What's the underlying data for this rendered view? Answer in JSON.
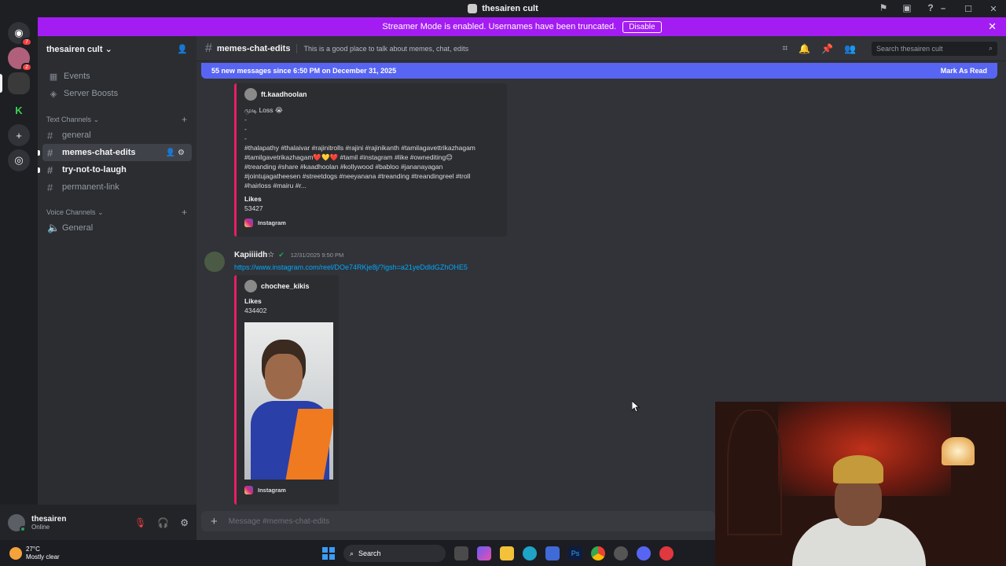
{
  "window": {
    "title": "thesairen cult",
    "controls": [
      "–",
      "☐",
      "✕"
    ]
  },
  "rail": {
    "badges": {
      "dm": "7",
      "friend": "2"
    }
  },
  "banner": {
    "text": "Streamer Mode is enabled. Usernames have been truncated.",
    "button": "Disable"
  },
  "server": {
    "name": "thesairen cult",
    "nav": [
      {
        "label": "Events",
        "icon": "calendar-icon"
      },
      {
        "label": "Server Boosts",
        "icon": "boost-icon"
      }
    ],
    "text_category": "Text Channels",
    "text_channels": [
      {
        "label": "general"
      },
      {
        "label": "memes-chat-edits",
        "active": true
      },
      {
        "label": "try-not-to-laugh",
        "unread": true
      },
      {
        "label": "permanent-link"
      }
    ],
    "voice_category": "Voice Channels",
    "voice_channels": [
      {
        "label": "General"
      }
    ]
  },
  "user": {
    "name": "thesairen",
    "status": "Online"
  },
  "channel": {
    "name": "memes-chat-edits",
    "topic": "This is a good place to talk about memes, chat, edits",
    "search_placeholder": "Search thesairen cult"
  },
  "new_messages": {
    "text": "55 new messages since 6:50 PM on December 31, 2025",
    "mark_read": "Mark As Read"
  },
  "embed1": {
    "author": "ft.kaadhoolan",
    "description_lines": [
      "முடி Loss 😭",
      "-",
      "-",
      "-",
      "#thalapathy #thalaivar #rajinitrolls #rajini #rajinikanth #tamilagavettrikazhagam",
      "#tamilgavetrikazhagam❤️💛❤️ #tamil #instagram #like #ownediting😊",
      "#treanding #share #kaadhoolan #kollywood #babloo #jananayagan",
      "#jointujagatheesen #streetdogs #neeyanana #treanding #treandingreel #troll",
      "#hairloss #mairu #r..."
    ],
    "field_name": "Likes",
    "field_value": "53427",
    "footer": "Instagram"
  },
  "message2": {
    "username": "Kapiiiidh☆",
    "tag": "✔",
    "timestamp": "12/31/2025 9:50 PM",
    "link": "https://www.instagram.com/reel/DOe74RKje8j/?igsh=a21yeDdldGZhOHE5",
    "embed": {
      "author": "chochee_kikis",
      "field_name": "Likes",
      "field_value": "434402",
      "footer": "Instagram"
    }
  },
  "composer": {
    "placeholder": "Message #memes-chat-edits"
  },
  "taskbar": {
    "temperature": "27°C",
    "weather": "Mostly clear",
    "search": "Search"
  }
}
